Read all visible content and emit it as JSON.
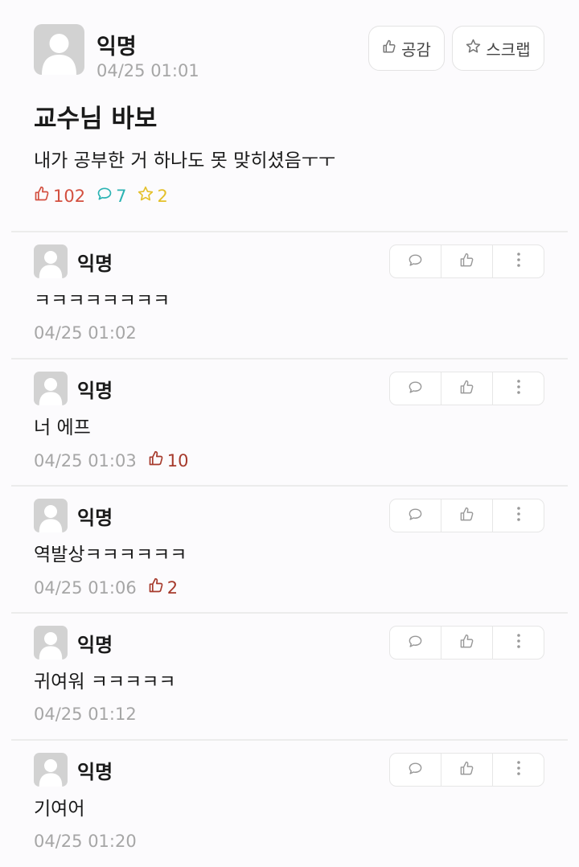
{
  "post": {
    "author": "익명",
    "time": "04/25 01:01",
    "like_button": "공감",
    "scrap_button": "스크랩",
    "title": "교수님 바보",
    "body": "내가 공부한 거 하나도 못 맞히셨음ㅜㅜ",
    "likes": "102",
    "comments": "7",
    "scraps": "2"
  },
  "comments": [
    {
      "author": "익명",
      "text": "ㅋㅋㅋㅋㅋㅋㅋㅋ",
      "time": "04/25 01:02",
      "likes": ""
    },
    {
      "author": "익명",
      "text": "너 에프",
      "time": "04/25 01:03",
      "likes": "10"
    },
    {
      "author": "익명",
      "text": "역발상ㅋㅋㅋㅋㅋㅋ",
      "time": "04/25 01:06",
      "likes": "2"
    },
    {
      "author": "익명",
      "text": "귀여워 ㅋㅋㅋㅋㅋ",
      "time": "04/25 01:12",
      "likes": ""
    },
    {
      "author": "익명",
      "text": "기여어",
      "time": "04/25 01:20",
      "likes": ""
    }
  ],
  "colors": {
    "like": "#d35040",
    "comment": "#2bb3b3",
    "scrap": "#e4c02a",
    "comment_like": "#a63a2c"
  },
  "icons": {
    "avatar": "default-user-avatar",
    "like": "thumbs-up-icon",
    "comment": "speech-bubble-icon",
    "scrap": "star-icon",
    "more": "vertical-dots-icon"
  }
}
